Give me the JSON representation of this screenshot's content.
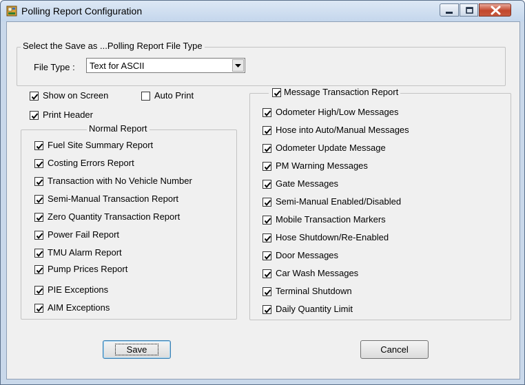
{
  "window": {
    "title": "Polling Report Configuration",
    "icon": "app-icon",
    "controls": [
      "minimize-icon",
      "maximize-icon",
      "close-icon"
    ]
  },
  "file_type_group": {
    "legend": "Select the Save as ...Polling Report File Type",
    "label": "File Type :",
    "selected": "Text for ASCII"
  },
  "options": {
    "show_on_screen": {
      "label": "Show on Screen",
      "checked": true
    },
    "auto_print": {
      "label": "Auto Print",
      "checked": false
    },
    "print_header": {
      "label": "Print Header",
      "checked": true
    }
  },
  "normal_report": {
    "legend": "Normal Report",
    "items": [
      {
        "label": "Fuel Site Summary Report",
        "checked": true
      },
      {
        "label": "Costing Errors Report",
        "checked": true
      },
      {
        "label": "Transaction with No Vehicle Number",
        "checked": true
      },
      {
        "label": "Semi-Manual Transaction Report",
        "checked": true
      },
      {
        "label": "Zero Quantity Transaction Report",
        "checked": true
      },
      {
        "label": "Power Fail Report",
        "checked": true
      },
      {
        "label": "TMU Alarm Report",
        "checked": true
      },
      {
        "label": "Pump Prices Report",
        "checked": true
      },
      {
        "label": "PIE Exceptions",
        "checked": true
      },
      {
        "label": "AIM Exceptions",
        "checked": true
      }
    ]
  },
  "message_report": {
    "legend": "Message Transaction Report",
    "checked": true,
    "items": [
      {
        "label": "Odometer High/Low Messages",
        "checked": true
      },
      {
        "label": "Hose into Auto/Manual Messages",
        "checked": true
      },
      {
        "label": "Odometer Update Message",
        "checked": true
      },
      {
        "label": "PM Warning Messages",
        "checked": true
      },
      {
        "label": "Gate Messages",
        "checked": true
      },
      {
        "label": "Semi-Manual Enabled/Disabled",
        "checked": true
      },
      {
        "label": "Mobile Transaction Markers",
        "checked": true
      },
      {
        "label": "Hose Shutdown/Re-Enabled",
        "checked": true
      },
      {
        "label": "Door Messages",
        "checked": true
      },
      {
        "label": "Car Wash Messages",
        "checked": true
      },
      {
        "label": "Terminal Shutdown",
        "checked": true
      },
      {
        "label": "Daily Quantity Limit",
        "checked": true
      }
    ]
  },
  "buttons": {
    "save": "Save",
    "cancel": "Cancel"
  },
  "colors": {
    "title_bar": "#c4d6ec",
    "dialog_bg": "#f0f0f0",
    "close_button": "#c2472d"
  }
}
